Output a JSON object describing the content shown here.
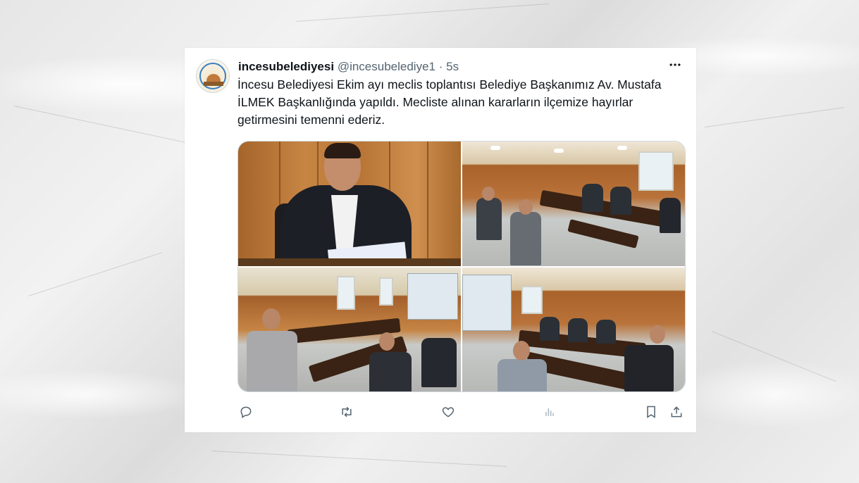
{
  "tweet": {
    "display_name": "incesubelediyesi",
    "handle": "@incesubelediye1",
    "separator": "·",
    "timestamp": "5s",
    "text": "İncesu Belediyesi Ekim ayı meclis toplantısı Belediye Başkanımız Av. Mustafa İLMEK Başkanlığında yapıldı. Mecliste alınan kararların ilçemize hayırlar getirmesini temenni ederiz.",
    "more_icon": "more-horizontal-icon",
    "media": [
      {
        "name": "photo-mayor-at-desk"
      },
      {
        "name": "photo-council-voting"
      },
      {
        "name": "photo-council-table-left"
      },
      {
        "name": "photo-council-table-right"
      }
    ],
    "actions": [
      {
        "name": "reply-button",
        "icon": "reply-icon"
      },
      {
        "name": "retweet-button",
        "icon": "retweet-icon"
      },
      {
        "name": "like-button",
        "icon": "heart-icon"
      },
      {
        "name": "views-button",
        "icon": "analytics-icon"
      },
      {
        "name": "bookmark-button",
        "icon": "bookmark-icon"
      },
      {
        "name": "share-button",
        "icon": "share-icon"
      }
    ]
  },
  "colors": {
    "text": "#0f1419",
    "secondary": "#536471",
    "border": "#cfd9de",
    "card": "#ffffff"
  }
}
